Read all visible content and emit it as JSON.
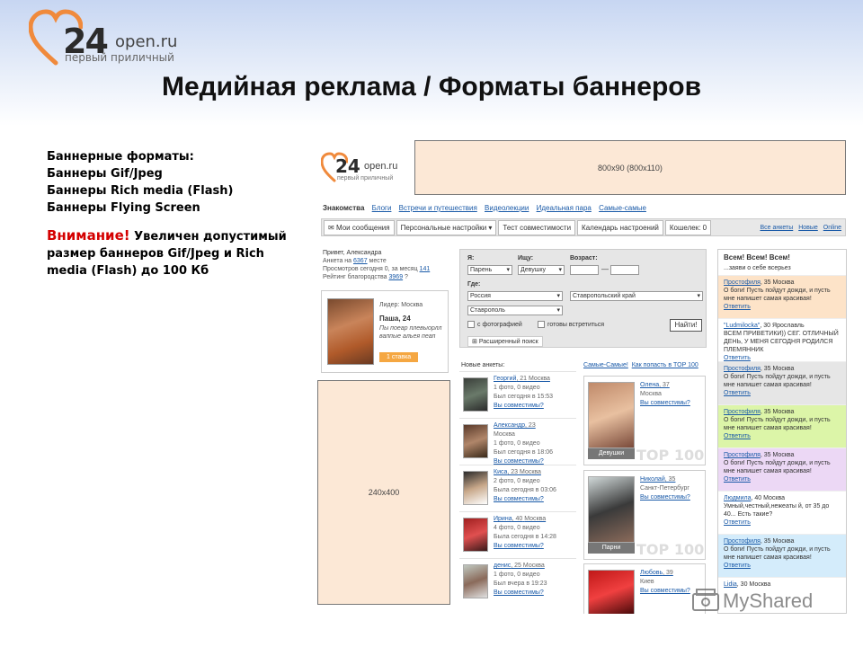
{
  "logo": {
    "num": "24",
    "domain": "open.ru",
    "tagline": "первый приличный"
  },
  "title": "Медийная реклама / Форматы баннеров",
  "left": {
    "lines": [
      "Баннерные форматы:",
      "Баннеры Gif/Jpeg",
      "Баннеры Rich media (Flash)",
      "Баннеры Flying Screen"
    ],
    "warning_label": "Внимание!",
    "warning_text": " Увеличен допустимый размер баннеров Gif/Jpeg  и Rich media (Flash) до 100 Кб"
  },
  "site": {
    "logo": {
      "num": "24",
      "domain": "open.ru",
      "tagline": "первый приличный"
    },
    "banner_top": "800x90 (800x110)",
    "banner_side": "240x400",
    "nav": [
      "Знакомства",
      "Блоги",
      "Встречи и путешествия",
      "Видеолекции",
      "Идеальная пара",
      "Самые-самые"
    ],
    "tabs": [
      "Мои сообщения",
      "Персональные настройки ▾",
      "Тест совместимости",
      "Календарь настроений",
      "Кошелек: 0"
    ],
    "tabs_right": [
      "Все анкеты",
      "Новые",
      "Online"
    ],
    "greet": {
      "l1": "Привет, Александра",
      "l2a": "Анкета на ",
      "l2b": "6367",
      "l2c": " месте",
      "l3a": "Просмотров сегодня ",
      "l3b": "0",
      "l3c": ", за месяц ",
      "l3d": "141",
      "l4a": "Рейтинг благородства ",
      "l4b": "3969",
      "l4c": " ?"
    },
    "leader": {
      "label": "Лидер: Москва",
      "name": "Паша, 24",
      "quote": "Пы поеар плевыорлл ваппые альея пеап",
      "stake": "1 ставка"
    },
    "search": {
      "i_label": "Я:",
      "i_value": "Парень",
      "seek_label": "Ищу:",
      "seek_value": "Девушку",
      "age_label": "Возраст:",
      "where_label": "Где:",
      "country": "Россия",
      "region": "Ставропольский край",
      "city": "Ставрополь",
      "photo_chk": "с фотографией",
      "meet_chk": "готовы встретиться",
      "find": "Найти!",
      "advanced": "Расширенный поиск"
    },
    "new_title": "Новые анкеты:",
    "top_title": "Самые-Самые!",
    "top_link": "Как попасть в TOP 100",
    "anketas": [
      {
        "name": "Георгий",
        "age": ", 21",
        "city": "Москва",
        "l1": "1 фото, 0 видео",
        "l2": "Был сегодня в 15:53"
      },
      {
        "name": "Александр",
        "age": ", 23",
        "city": "Москва",
        "l1": "1 фото, 0 видео",
        "l2": "Был сегодня в 18:06"
      },
      {
        "name": "Киса",
        "age": ", 23",
        "city": "Москва",
        "l1": "2 фото, 0 видео",
        "l2": "Была сегодня в 03:06"
      },
      {
        "name": "Ирина",
        "age": ", 40",
        "city": "Москва",
        "l1": "4 фото, 0 видео",
        "l2": "Была сегодня в 14:28"
      },
      {
        "name": "денис",
        "age": ", 25",
        "city": "Москва",
        "l1": "1 фото, 0 видео",
        "l2": "Был вчера в 19:23"
      }
    ],
    "compat": "Вы совместимы?",
    "tops": [
      {
        "name": "Олена",
        "age": ", 37",
        "city": "Москва",
        "badge": "Девушки",
        "mark": "TOP 100"
      },
      {
        "name": "Николай",
        "age": ", 35",
        "city": "Санкт-Петербург",
        "badge": "Парни",
        "mark": "TOP 100"
      },
      {
        "name": "Любовь",
        "age": ", 39",
        "city": "Киев",
        "badge": "",
        "mark": ""
      }
    ],
    "feed": {
      "title": "Всем! Всем! Всем!",
      "sub": "...заяви о себе всерьез",
      "items": [
        {
          "name": "Простофиля",
          "meta": ", 35 Москва",
          "text": "О боги! Пусть пойдут дожди, и пусть мне напишет самая красивая!",
          "bg": "#fde3c8"
        },
        {
          "name": "\"Ludmilocka\"",
          "meta": ", 30 Ярославль",
          "text": "ВСЕМ ПРИВЕТИКИ)) СЕГ. ОТЛИЧНЫЙ ДЕНЬ, У МЕНЯ СЕГОДНЯ РОДИЛСЯ ПЛЕМЯННИК",
          "bg": "#ffffff"
        },
        {
          "name": "Простофиля",
          "meta": ", 35 Москва",
          "text": "О боги! Пусть пойдут дожди, и пусть мне напишет самая красивая!",
          "bg": "#e6e6e6"
        },
        {
          "name": "Простофиля",
          "meta": ", 35 Москва",
          "text": "О боги! Пусть пойдут дожди, и пусть мне напишет самая красивая!",
          "bg": "#dcf5a8"
        },
        {
          "name": "Простофиля",
          "meta": ", 35 Москва",
          "text": "О боги! Пусть пойдут дожди, и пусть мне напишет самая красивая!",
          "bg": "#ecd8f5"
        },
        {
          "name": "Людмила",
          "meta": ", 40 Москва",
          "text": "Умный,честный,нежеаты й, от 35 до 40... Есть такие?",
          "bg": "#ffffff"
        },
        {
          "name": "Простофиля",
          "meta": ", 35 Москва",
          "text": "О боги! Пусть пойдут дожди, и пусть мне напишет самая красивая!",
          "bg": "#d4ecfb"
        },
        {
          "name": "Lidia",
          "meta": ", 30 Москва",
          "text": "",
          "bg": "#ffffff"
        }
      ],
      "answer": "Ответить"
    }
  },
  "watermark": "MyShared"
}
